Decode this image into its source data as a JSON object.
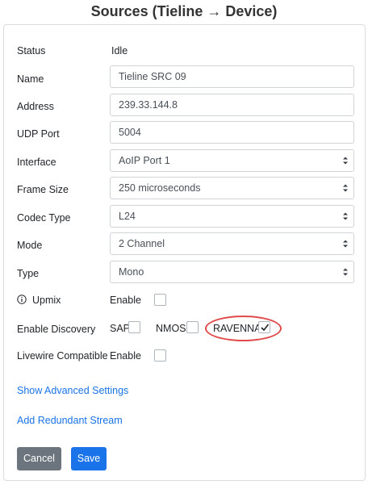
{
  "title": "Sources (Tieline → Device)",
  "form": {
    "status": {
      "label": "Status",
      "value": "Idle"
    },
    "name": {
      "label": "Name",
      "value": "Tieline SRC 09"
    },
    "address": {
      "label": "Address",
      "value": "239.33.144.8"
    },
    "udp_port": {
      "label": "UDP Port",
      "value": "5004"
    },
    "interface": {
      "label": "Interface",
      "value": "AoIP Port 1"
    },
    "frame_size": {
      "label": "Frame Size",
      "value": "250 microseconds"
    },
    "codec_type": {
      "label": "Codec Type",
      "value": "L24"
    },
    "mode": {
      "label": "Mode",
      "value": "2 Channel"
    },
    "type": {
      "label": "Type",
      "value": "Mono"
    },
    "upmix": {
      "label": "Upmix",
      "option": "Enable",
      "checked": false
    },
    "discovery": {
      "label": "Enable Discovery",
      "sap": {
        "label": "SAP",
        "checked": false
      },
      "nmos": {
        "label": "NMOS",
        "checked": false
      },
      "ravenna": {
        "label": "RAVENNA",
        "checked": true
      }
    },
    "livewire": {
      "label": "Livewire Compatible",
      "option": "Enable",
      "checked": false
    }
  },
  "links": {
    "advanced": "Show Advanced Settings",
    "redundant": "Add Redundant Stream"
  },
  "buttons": {
    "cancel": "Cancel",
    "save": "Save"
  },
  "colors": {
    "accent": "#1a73e8",
    "cancel_bg": "#6c757d",
    "highlight": "#e04a4a"
  },
  "icons": {
    "info": "info-circle-icon",
    "select_arrows": "select-arrows-icon",
    "check": "checkmark-icon"
  }
}
